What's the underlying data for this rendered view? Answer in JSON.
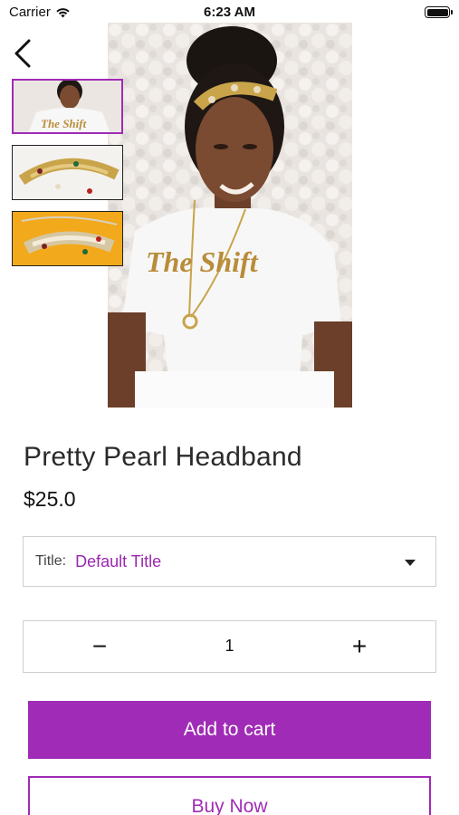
{
  "status_bar": {
    "carrier": "Carrier",
    "time": "6:23 AM",
    "icons": [
      "wifi-icon",
      "battery-icon"
    ]
  },
  "navigation": {
    "back_icon": "chevron-left-icon"
  },
  "gallery": {
    "main_image": "product-photo-woman-in-the-shift-tshirt-with-headband",
    "shirt_text": "The Shift",
    "thumbnails": [
      {
        "image": "model-wearing-headband",
        "selected": true
      },
      {
        "image": "gold-headband-white-background",
        "selected": false
      },
      {
        "image": "gold-headband-yellow-background",
        "selected": false
      }
    ]
  },
  "product": {
    "title": "Pretty Pearl Headband",
    "price": "$25.0"
  },
  "variant": {
    "label": "Title:",
    "value": "Default Title",
    "icon": "caret-down-icon"
  },
  "quantity": {
    "minus": "−",
    "value": "1",
    "plus": "+"
  },
  "actions": {
    "add_to_cart": "Add to cart",
    "buy_now": "Buy Now"
  },
  "colors": {
    "accent": "#a02bb6",
    "border": "#cfcfcf",
    "text": "#222222"
  }
}
